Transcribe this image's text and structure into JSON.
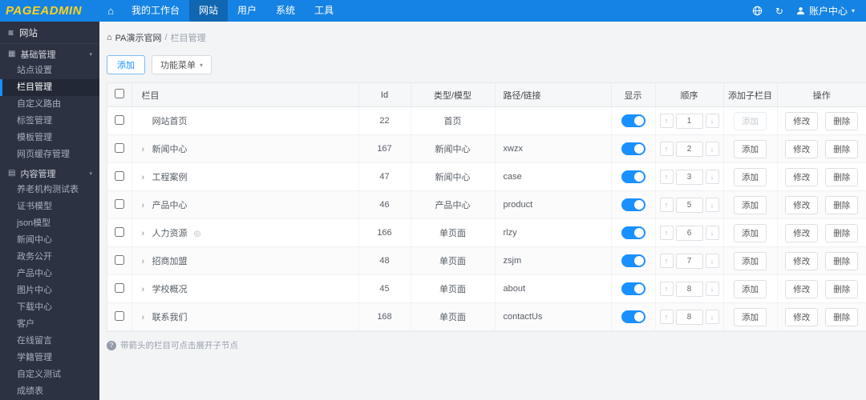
{
  "navbar": {
    "logo": "PAGEADMIN",
    "items": [
      {
        "label": "我的工作台",
        "active": false
      },
      {
        "label": "网站",
        "active": true
      },
      {
        "label": "用户",
        "active": false
      },
      {
        "label": "系统",
        "active": false
      },
      {
        "label": "工具",
        "active": false
      }
    ],
    "account_label": "账户中心"
  },
  "icons": {
    "home": "⌂",
    "menu": "≡",
    "grid": "▦",
    "document": "▤",
    "chevron_down": "▾",
    "caret_down": "▾",
    "refresh": "↻",
    "expand_arrow": "›",
    "eye": "◎",
    "arrow_up": "↑",
    "arrow_down": "↓",
    "note": "?"
  },
  "sidebar": {
    "title": "网站",
    "groups": [
      {
        "label": "基础管理",
        "icon": "grid",
        "items": [
          "站点设置",
          "栏目管理",
          "自定义路由",
          "标签管理",
          "模板管理",
          "网页缓存管理"
        ],
        "active_item": "栏目管理"
      },
      {
        "label": "内容管理",
        "icon": "document",
        "items": [
          "养老机构测试表",
          "证书模型",
          "json模型",
          "新闻中心",
          "政务公开",
          "产品中心",
          "图片中心",
          "下载中心",
          "客户",
          "在线留言",
          "学籍管理",
          "自定义测试",
          "成绩表"
        ],
        "active_item": ""
      }
    ]
  },
  "breadcrumb": {
    "site": "PA演示官网",
    "separator": "/",
    "page": "栏目管理"
  },
  "toolbar": {
    "add_label": "添加",
    "menu_label": "功能菜单"
  },
  "table": {
    "headers": [
      "栏目",
      "Id",
      "类型/模型",
      "路径/链接",
      "显示",
      "顺序",
      "添加子栏目",
      "操作"
    ],
    "add_child_label": "添加",
    "modify_label": "修改",
    "delete_label": "删除",
    "rows": [
      {
        "name": "网站首页",
        "expandable": false,
        "eye": false,
        "id": "22",
        "type": "首页",
        "path": "",
        "visible": true,
        "order": "1",
        "add_disabled": true
      },
      {
        "name": "新闻中心",
        "expandable": true,
        "eye": false,
        "id": "167",
        "type": "新闻中心",
        "path": "xwzx",
        "visible": true,
        "order": "2",
        "add_disabled": false
      },
      {
        "name": "工程案例",
        "expandable": true,
        "eye": false,
        "id": "47",
        "type": "新闻中心",
        "path": "case",
        "visible": true,
        "order": "3",
        "add_disabled": false
      },
      {
        "name": "产品中心",
        "expandable": true,
        "eye": false,
        "id": "46",
        "type": "产品中心",
        "path": "product",
        "visible": true,
        "order": "5",
        "add_disabled": false
      },
      {
        "name": "人力资源",
        "expandable": true,
        "eye": true,
        "id": "166",
        "type": "单页面",
        "path": "rlzy",
        "visible": true,
        "order": "6",
        "add_disabled": false
      },
      {
        "name": "招商加盟",
        "expandable": true,
        "eye": false,
        "id": "48",
        "type": "单页面",
        "path": "zsjm",
        "visible": true,
        "order": "7",
        "add_disabled": false
      },
      {
        "name": "学校概况",
        "expandable": true,
        "eye": false,
        "id": "45",
        "type": "单页面",
        "path": "about",
        "visible": true,
        "order": "8",
        "add_disabled": false
      },
      {
        "name": "联系我们",
        "expandable": true,
        "eye": false,
        "id": "168",
        "type": "单页面",
        "path": "contactUs",
        "visible": true,
        "order": "8",
        "add_disabled": false
      }
    ]
  },
  "footnote": "带箭头的栏目可点击展开子节点"
}
